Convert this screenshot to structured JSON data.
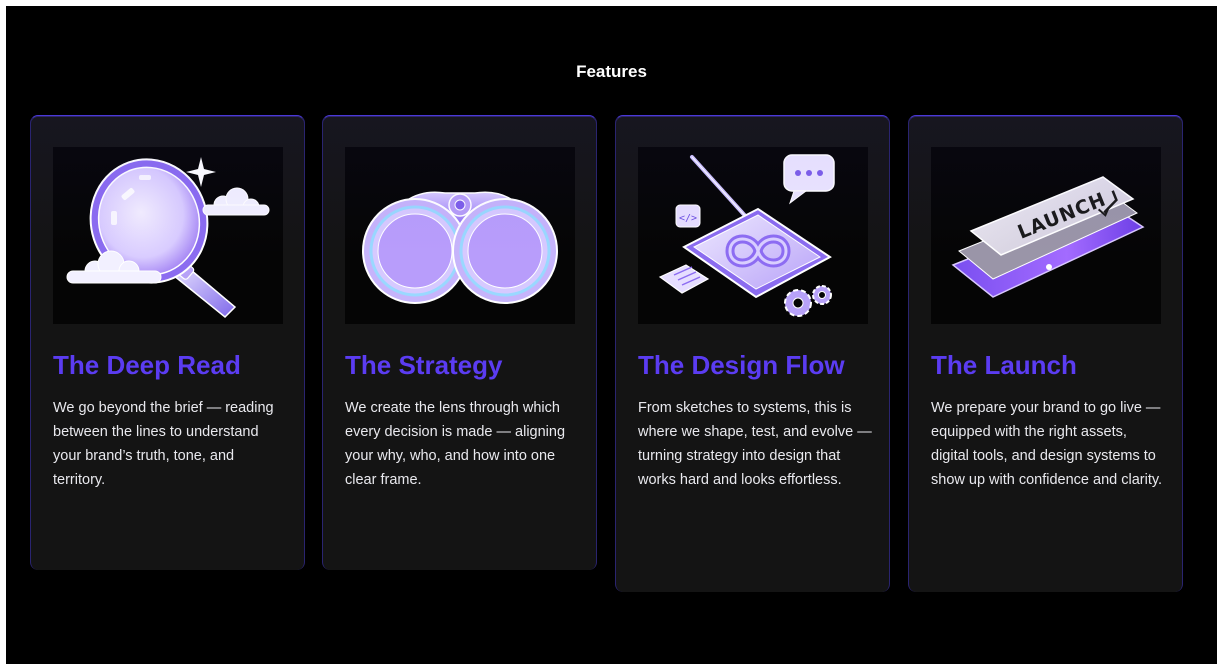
{
  "section": {
    "title": "Features"
  },
  "theme": {
    "background": "#000000",
    "card_background": "#141414",
    "accent": "#5b3cf2",
    "text": "#e9e9ee"
  },
  "features": [
    {
      "title": "The Deep Read",
      "description": "We go beyond the brief — reading between the lines to understand your brand’s truth, tone, and territory.",
      "icon": "magnifying-glass-icon"
    },
    {
      "title": "The Strategy",
      "description": "We create the lens through which every decision is made — aligning your why, who, and how into one clear frame.",
      "icon": "binoculars-icon"
    },
    {
      "title": "The Design Flow",
      "description": "From sketches to systems, this is where we shape, test, and evolve — turning strategy into design that works hard and looks effortless.",
      "icon": "design-tablet-icon"
    },
    {
      "title": "The Launch",
      "description": "We prepare your brand to go live — equipped with the right assets, digital tools, and design systems to show up with confidence and clarity.",
      "icon": "launch-key-icon",
      "key_label": "LAUNCH"
    }
  ]
}
